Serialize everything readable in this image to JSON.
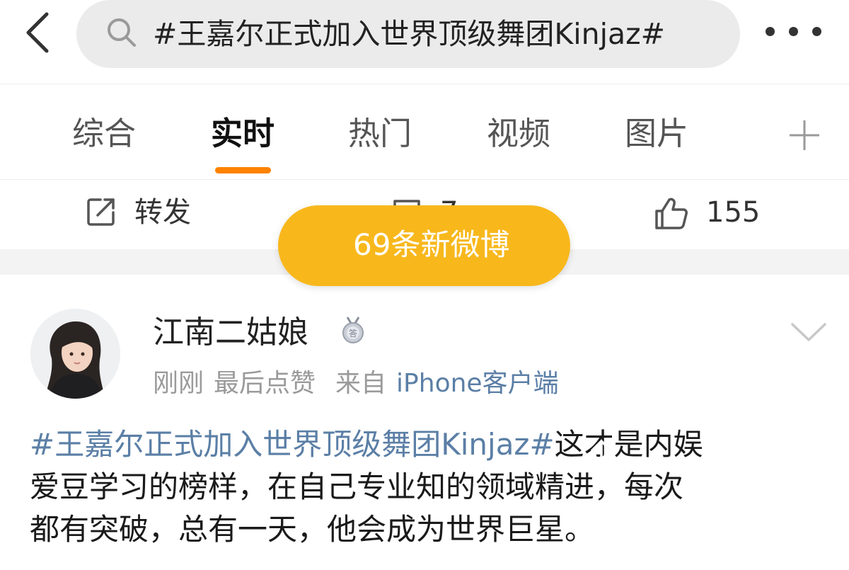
{
  "search": {
    "query": "#王嘉尔正式加入世界顶级舞团Kinjaz#"
  },
  "tabs": [
    {
      "label": "综合",
      "active": false
    },
    {
      "label": "实时",
      "active": true
    },
    {
      "label": "热门",
      "active": false
    },
    {
      "label": "视频",
      "active": false
    },
    {
      "label": "图片",
      "active": false
    }
  ],
  "accent_color": "#ff8200",
  "prev_post_actions": {
    "repost_label": "转发",
    "comment_count": "7",
    "like_count": "155"
  },
  "new_posts_pill": {
    "label": "69条新微博",
    "color": "#f8b81c"
  },
  "post": {
    "author": "江南二姑娘",
    "time": "刚刚",
    "activity": "最后点赞",
    "source_prefix": "来自",
    "source": "iPhone客户端",
    "hashtag": "#王嘉尔正式加入世界顶级舞团Kinjaz#",
    "text_line1_rest": "这才是内娱",
    "text_line2": "爱豆学习的榜样，在自己专业知的领域精进，每次",
    "text_line3": "都有突破，总有一天，他会成为世界巨星。",
    "link_color": "#5b7fa6"
  }
}
